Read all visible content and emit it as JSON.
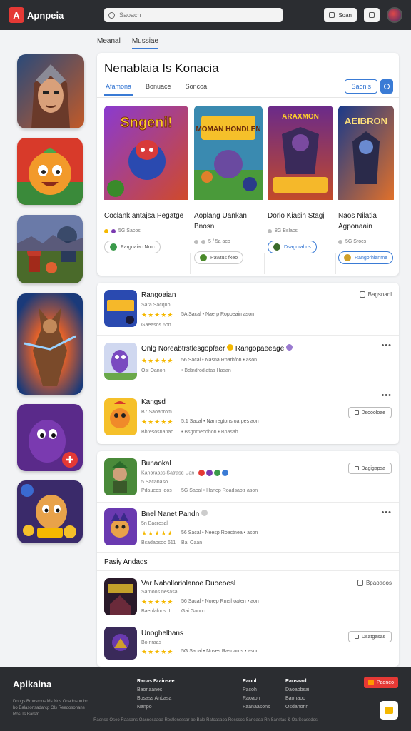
{
  "header": {
    "logo_mark": "A",
    "logo_text": "Apnpeia",
    "search_placeholder": "Saoach",
    "btn1_label": "Soan",
    "icons": [
      "search-icon",
      "square-icon",
      "bag-icon"
    ]
  },
  "page_tabs": [
    {
      "label": "Meanal",
      "active": false
    },
    {
      "label": "Mussiae",
      "active": true
    }
  ],
  "featured": {
    "title": "Nenablaia Is Konacia",
    "tabs": [
      {
        "label": "Afamona",
        "active": true
      },
      {
        "label": "Bonuace",
        "active": false
      },
      {
        "label": "Soncoa",
        "active": false
      }
    ],
    "action_label": "Saonis",
    "games": [
      {
        "art_title": "Sngeni!",
        "name": "Coclank antajsa Pegatge",
        "meta": "5G Sacos",
        "pill": "Pargoaiac Nrnc",
        "pill_blue": false
      },
      {
        "art_title": "MOMAN HONDLEN",
        "name": "Aoplang Uankan Bnosn",
        "meta": "5 / 5a aco",
        "pill": "Pawtus fxeo",
        "pill_blue": false
      },
      {
        "art_title": "ARAXMON",
        "name": "Dorlo Kiasin Stagj",
        "meta": "8G Bslacs",
        "pill": "Dsagorahos",
        "pill_blue": true
      },
      {
        "art_title": "AEIBRON",
        "name": "Naos Nilatia Agponaain",
        "meta": "5G Srocs",
        "pill": "Rangorhianme",
        "pill_blue": true
      }
    ]
  },
  "list1": [
    {
      "title": "Rangoaian",
      "sub": "Sara Sacquo",
      "stars": "★★★★★",
      "stats": "5A Sacal  •  Naerp Ropoeain ason",
      "sub2": "Gaeasos 6on",
      "sub2b": "",
      "action": "Bagsnanl",
      "action_type": "link"
    },
    {
      "title": "Onlg Noreabtrstlesgopfaer",
      "title_extra": "Rangopaeeage",
      "sub": "",
      "stars": "★★★★★",
      "stats": "56 Sacal  •  Nasna Rnarbfon  •  ason",
      "sub2": "Osi Oanon",
      "sub2b": "•  Bdtndrodlatas Hasan",
      "action": "•••",
      "action_type": "more"
    },
    {
      "title": "Kangsd",
      "sub": "B7 Saoanrom",
      "stars": "★★★★★",
      "stats": "5.1 Sacal  •  Nanregtons oarpes aon",
      "sub2": "Bbresosnanao",
      "sub2b": "•  Bsgomeodhon  •  Bpasah",
      "action": "Dsoooloae",
      "action_type": "pill",
      "more": "•••"
    }
  ],
  "list2": [
    {
      "title": "Bunaokal",
      "sub": "Kanoraacs Satrasq Uan",
      "sub_b": "5 Sacanaso",
      "stars": "",
      "stats": "",
      "sub2": "Pdaueos Idos",
      "sub2b": "5G Sacal  •  Hanep Roadsaotr ason",
      "action": "Dagigapsa",
      "action_type": "pill"
    },
    {
      "title": "Bnel Nanet Pandn",
      "sub": "5n Bacrosal",
      "stars": "★★★★★",
      "stats": "56 Sacal  •  Neesp Roactnea  •  ason",
      "sub2": "Bcadaosoo 611",
      "sub2b": "Bai Oaan",
      "action": "•••",
      "action_type": "more"
    }
  ],
  "section_label": "Pasiy Andads",
  "list3": [
    {
      "title": "Var Nabolloriolanoe Duoeoesl",
      "sub": "Sarnoos nesasa",
      "stars": "★★★★★",
      "stats": "56 Sacal  •  Norep Rnrshoaten  •  aon",
      "sub2": "Baeolalons II",
      "sub2b": "Gai Ganoo",
      "action": "Bpaoaoos",
      "action_type": "link"
    },
    {
      "title": "Unoghelbans",
      "sub": "Bo nraas",
      "stars": "★★★★★",
      "stats": "5G Sacal  •  Noses Rasoarns  •  ason",
      "sub2": "",
      "sub2b": "",
      "action": "Dsatgasas",
      "action_type": "pill"
    }
  ],
  "footer": {
    "brand": "Apikaina",
    "desc": "Dongs Bmosroos Ms Nos Ooadoson bo bo Balasonsadarcp Ols Reedosonans Ros Ts Barstn",
    "cols": [
      {
        "head": "Ranas Braiosee",
        "items": [
          "Baonaanes",
          "Bosass Anbasa",
          "Nanpo"
        ]
      },
      {
        "head": "Raonl",
        "items": [
          "Pacoh",
          "Raoaoh",
          "Faanaasons"
        ]
      },
      {
        "head": "Raosaarl",
        "items": [
          "Daoaobsai",
          "Baonaoc",
          "Osdanorin"
        ]
      }
    ],
    "btn_label": "Paoneo",
    "copyright": "Raonse Oseo Raasans Oasnosaaoa Rostlonessar be Bale Ratoasaoa Rosssoc Sanoada Rn Sanstas & Oa Soasodos"
  },
  "colors": {
    "accent": "#3a7bd5",
    "brand": "#e53935",
    "header_bg": "#2b2d31",
    "star": "#f5b800"
  }
}
